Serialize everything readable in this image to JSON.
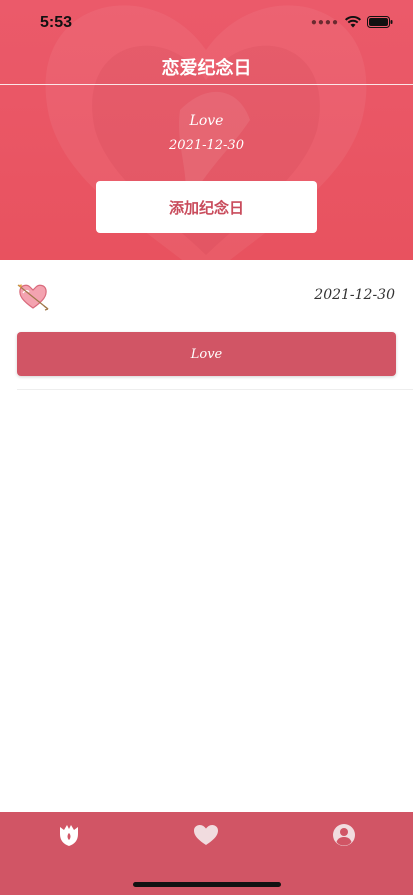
{
  "status": {
    "time": "5:53"
  },
  "header": {
    "title": "恋爱纪念日"
  },
  "hero": {
    "name": "Love",
    "date": "2021-12-30",
    "add_button_label": "添加纪念日"
  },
  "anniversary": {
    "date": "2021-12-30",
    "name": "Love"
  },
  "tabs": [
    {
      "icon": "rose-icon",
      "label": ""
    },
    {
      "icon": "heart-icon",
      "label": ""
    },
    {
      "icon": "user-icon",
      "label": ""
    }
  ],
  "colors": {
    "accent": "#e8525f",
    "tab_bar": "#d15565",
    "card_button": "#d15565"
  }
}
